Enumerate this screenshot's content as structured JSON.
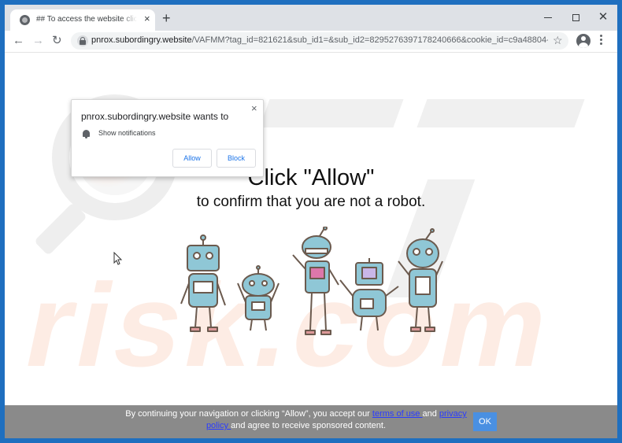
{
  "browser": {
    "tab_title": "## To access the website click the",
    "tab_close": "×",
    "new_tab": "+",
    "url_host": "pnrox.subordingry.website",
    "url_path": "/VAFMM?tag_id=821621&sub_id1=&sub_id2=8295276397178240666&cookie_id=c9a48804-b...",
    "window_controls": {
      "minimize": "minimize-icon",
      "maximize": "maximize-icon",
      "close": "✕"
    },
    "nav": {
      "back": "←",
      "forward": "→",
      "reload": "↻",
      "star": "☆"
    }
  },
  "popup": {
    "title": "pnrox.subordingry.website wants to",
    "permission": "Show notifications",
    "allow_label": "Allow",
    "block_label": "Block",
    "close": "×"
  },
  "page": {
    "headline": "Click \"Allow\"",
    "subline": "to confirm that you are not a robot.",
    "watermark": "risk.com"
  },
  "consent": {
    "text_1": "By continuing your navigation or clicking “Allow”, you accept our ",
    "link_terms": "terms of use ",
    "text_2": "and ",
    "link_privacy": "privacy policy ",
    "text_3": "and agree to receive sponsored content.",
    "ok_label": "OK"
  },
  "colors": {
    "frame": "#1f6fbf",
    "robot_fill": "#8fc7d6",
    "robot_stroke": "#6b5a4e",
    "link": "#2a3cff",
    "ok_button": "#4a90e2"
  }
}
